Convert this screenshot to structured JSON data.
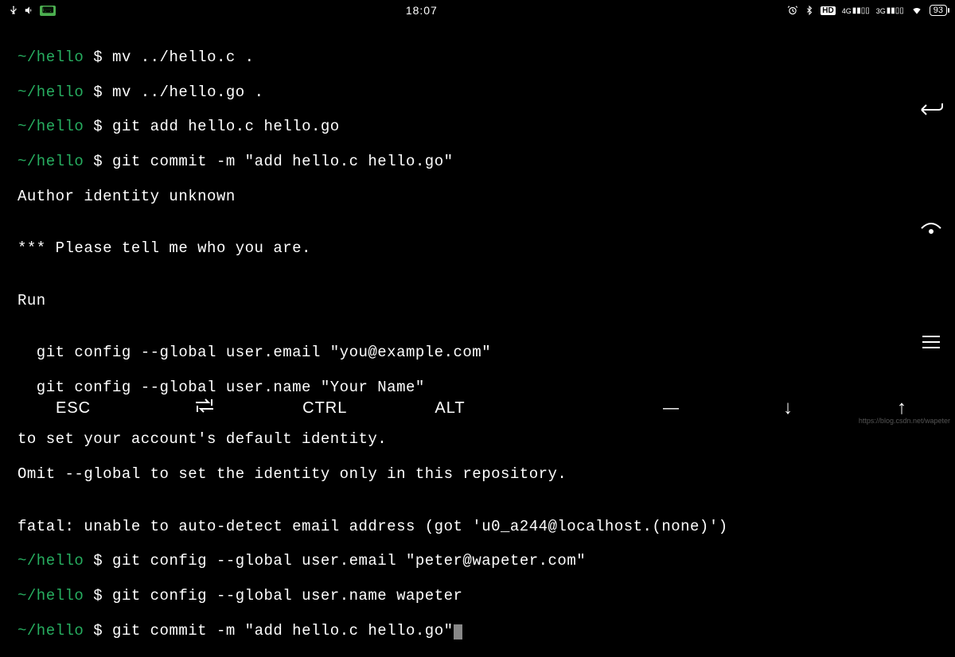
{
  "statusbar": {
    "clock": "18:07",
    "battery": "93",
    "net1": "4G",
    "net2": "3G",
    "hd": "HD"
  },
  "term": {
    "prompt_path": "~/hello",
    "dollar": "$",
    "lines": {
      "l1_cmd": "mv ../hello.c .",
      "l2_cmd": "mv ../hello.go .",
      "l3_cmd": "git add hello.c hello.go",
      "l4_cmd": "git commit -m \"add hello.c hello.go\"",
      "l5": "Author identity unknown",
      "l6": "",
      "l7": "*** Please tell me who you are.",
      "l8": "",
      "l9": "Run",
      "l10": "",
      "l11": "  git config --global user.email \"you@example.com\"",
      "l12": "  git config --global user.name \"Your Name\"",
      "l13": "",
      "l14": "to set your account's default identity.",
      "l15": "Omit --global to set the identity only in this repository.",
      "l16": "",
      "l17": "fatal: unable to auto-detect email address (got 'u0_a244@localhost.(none)')",
      "l18_cmd": "git config --global user.email \"peter@wapeter.com\"",
      "l19_cmd": "git config --global user.name wapeter",
      "l20_cmd": "git commit -m \"add hello.c hello.go\""
    }
  },
  "bottombar": {
    "esc": "ESC",
    "tab": "⇄",
    "ctrl": "CTRL",
    "alt": "ALT",
    "dash": "—",
    "down": "↓",
    "up": "↑"
  },
  "watermark": "https://blog.csdn.net/wapeter"
}
